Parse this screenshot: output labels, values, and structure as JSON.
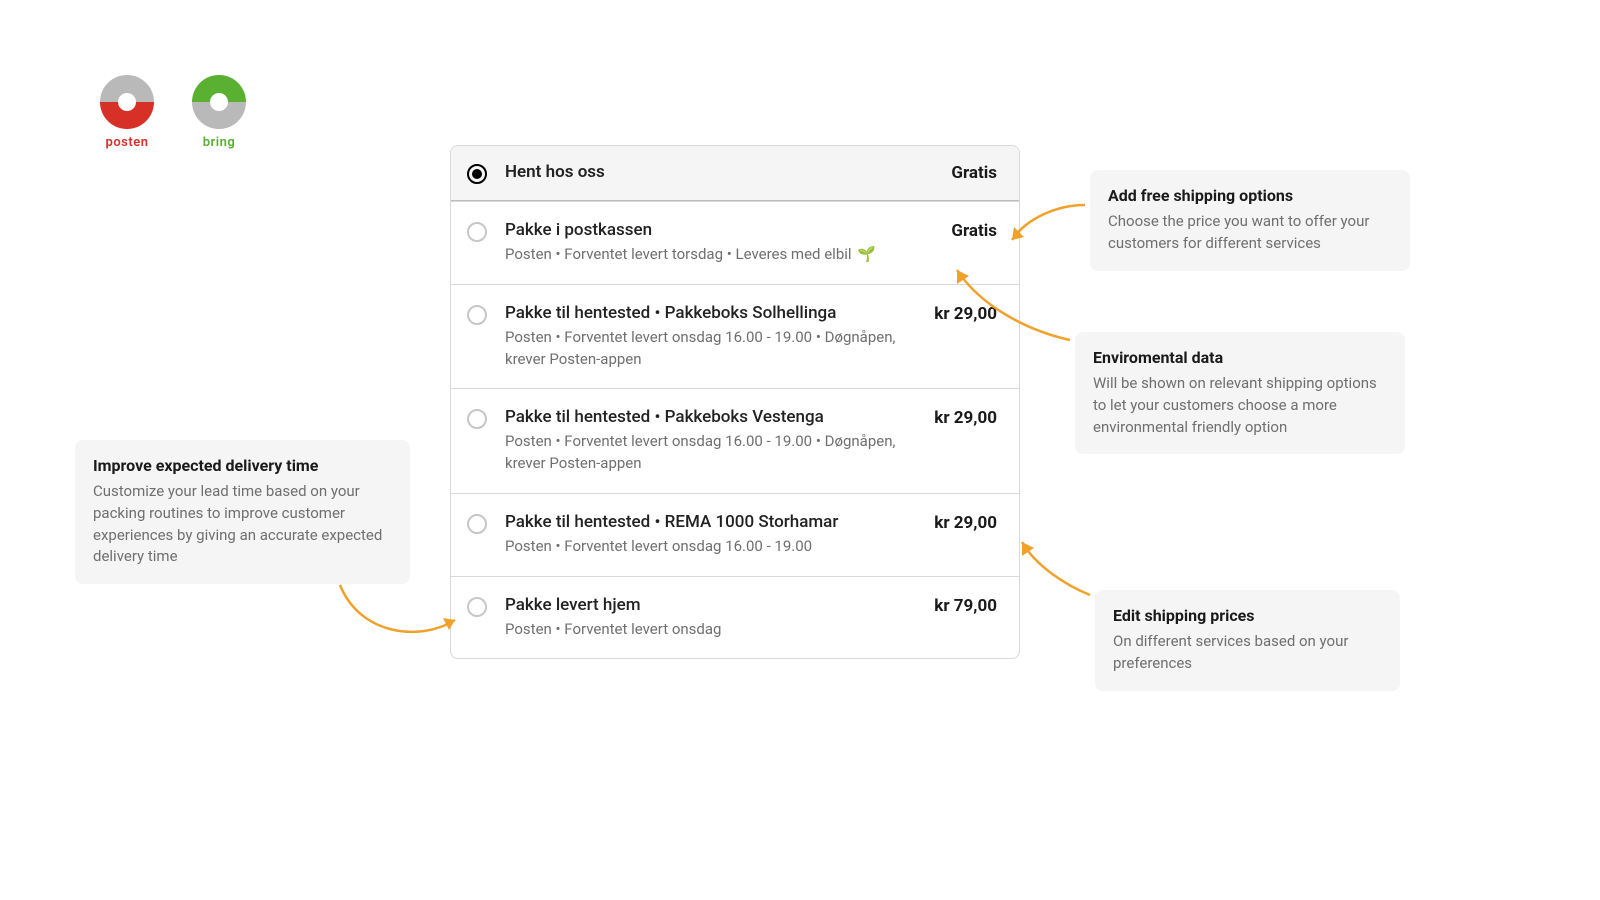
{
  "logos": {
    "posten": "posten",
    "bring": "bring"
  },
  "shipping": {
    "header": {
      "title": "Hent hos oss",
      "price": "Gratis"
    },
    "options": [
      {
        "title": "Pakke i postkassen",
        "desc": "Posten • Forventet levert torsdag • Leveres med elbil",
        "leaf": "🌱",
        "price": "Gratis"
      },
      {
        "title": "Pakke til hentested • Pakkeboks Solhellinga",
        "desc": "Posten • Forventet levert onsdag 16.00 - 19.00 • Døgnåpen, krever Posten-appen",
        "price": "kr 29,00"
      },
      {
        "title": "Pakke til hentested • Pakkeboks Vestenga",
        "desc": "Posten • Forventet levert onsdag 16.00 - 19.00 • Døgnåpen, krever Posten-appen",
        "price": "kr 29,00"
      },
      {
        "title": "Pakke til hentested • REMA 1000 Storhamar",
        "desc": "Posten • Forventet levert onsdag 16.00 - 19.00",
        "price": "kr 29,00"
      },
      {
        "title": "Pakke levert hjem",
        "desc": "Posten • Forventet levert onsdag",
        "price": "kr 79,00"
      }
    ]
  },
  "callouts": {
    "delivery": {
      "title": "Improve expected delivery time",
      "body": "Customize your lead time based on your packing routines to improve customer experiences by giving an accurate expected delivery time"
    },
    "free": {
      "title": "Add free shipping options",
      "body": "Choose the price you want to offer your customers for different services"
    },
    "env": {
      "title": "Enviromental data",
      "body": "Will be shown on relevant shipping options to let your customers choose a more environmental friendly option"
    },
    "prices": {
      "title": "Edit shipping prices",
      "body": "On different services based on your preferences"
    }
  }
}
